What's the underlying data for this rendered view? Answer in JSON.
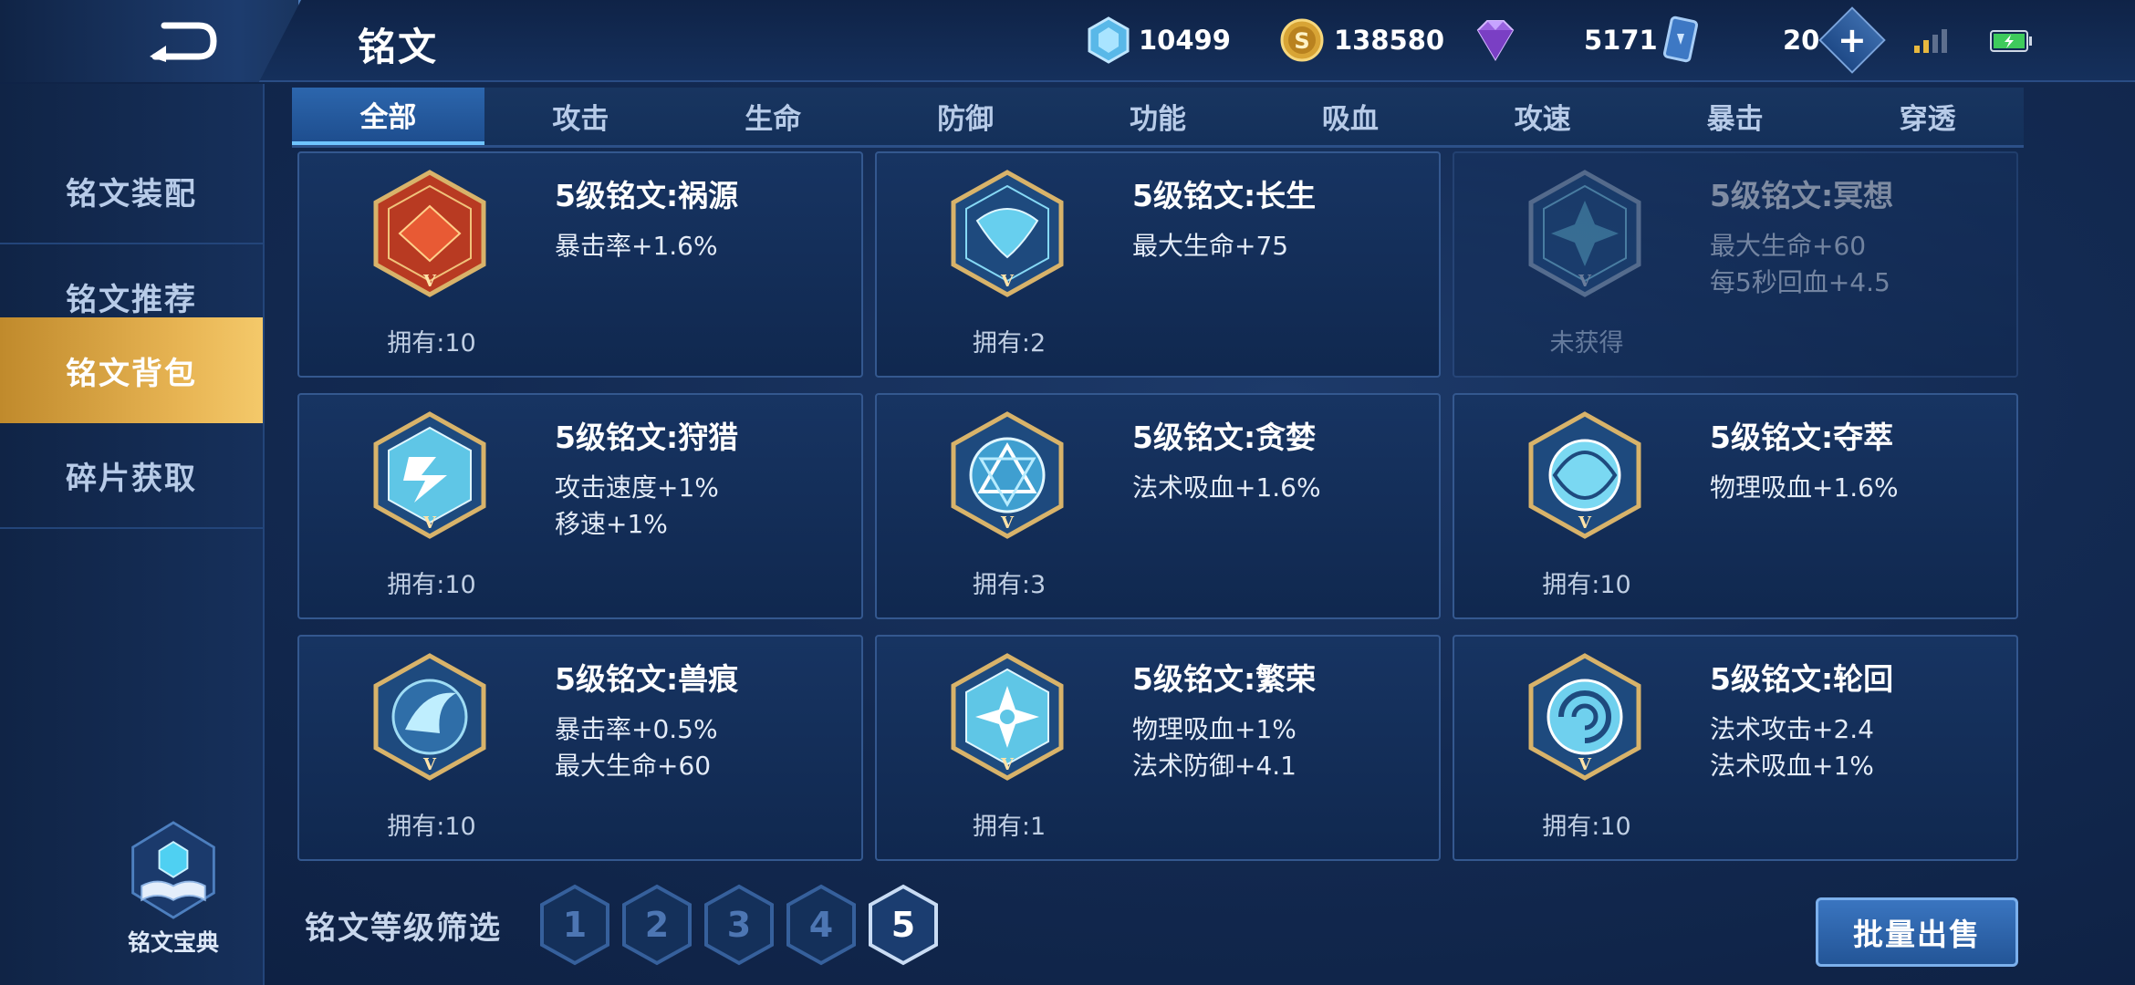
{
  "header": {
    "title": "铭文",
    "resources": {
      "diamond": "10499",
      "gold": "138580",
      "gem": "5171",
      "card": "20"
    }
  },
  "sidebar": {
    "items": [
      {
        "label": "铭文装配"
      },
      {
        "label": "铭文推荐"
      },
      {
        "label": "铭文背包"
      },
      {
        "label": "碎片获取"
      }
    ],
    "active_index": 2,
    "codex_label": "铭文宝典"
  },
  "tabs": [
    "全部",
    "攻击",
    "生命",
    "防御",
    "功能",
    "吸血",
    "攻速",
    "暴击",
    "穿透"
  ],
  "active_tab": 0,
  "runes": [
    {
      "name": "5级铭文:祸源",
      "stats": [
        "暴击率+1.6%",
        ""
      ],
      "owned": "拥有:10",
      "color": "red"
    },
    {
      "name": "5级铭文:长生",
      "stats": [
        "最大生命+75",
        ""
      ],
      "owned": "拥有:2",
      "color": "blue"
    },
    {
      "name": "5级铭文:冥想",
      "stats": [
        "最大生命+60",
        "每5秒回血+4.5"
      ],
      "owned": "未获得",
      "color": "blue"
    },
    {
      "name": "5级铭文:狩猎",
      "stats": [
        "攻击速度+1%",
        "移速+1%"
      ],
      "owned": "拥有:10",
      "color": "blue"
    },
    {
      "name": "5级铭文:贪婪",
      "stats": [
        "法术吸血+1.6%",
        ""
      ],
      "owned": "拥有:3",
      "color": "blue"
    },
    {
      "name": "5级铭文:夺萃",
      "stats": [
        "物理吸血+1.6%",
        ""
      ],
      "owned": "拥有:10",
      "color": "blue"
    },
    {
      "name": "5级铭文:兽痕",
      "stats": [
        "暴击率+0.5%",
        "最大生命+60"
      ],
      "owned": "拥有:10",
      "color": "blue"
    },
    {
      "name": "5级铭文:繁荣",
      "stats": [
        "物理吸血+1%",
        "法术防御+4.1"
      ],
      "owned": "拥有:1",
      "color": "blue"
    },
    {
      "name": "5级铭文:轮回",
      "stats": [
        "法术攻击+2.4",
        "法术吸血+1%"
      ],
      "owned": "拥有:10",
      "color": "blue"
    }
  ],
  "filter": {
    "label": "铭文等级筛选",
    "levels": [
      "1",
      "2",
      "3",
      "4",
      "5"
    ],
    "active_level": "5"
  },
  "bulk_sell_label": "批量出售",
  "colors": {
    "accent_gold": "#e8b554",
    "tab_active": "#2c66ad",
    "card_bg": "#173462",
    "red_rune": "#c83a22",
    "blue_rune": "#5fc6e6"
  }
}
